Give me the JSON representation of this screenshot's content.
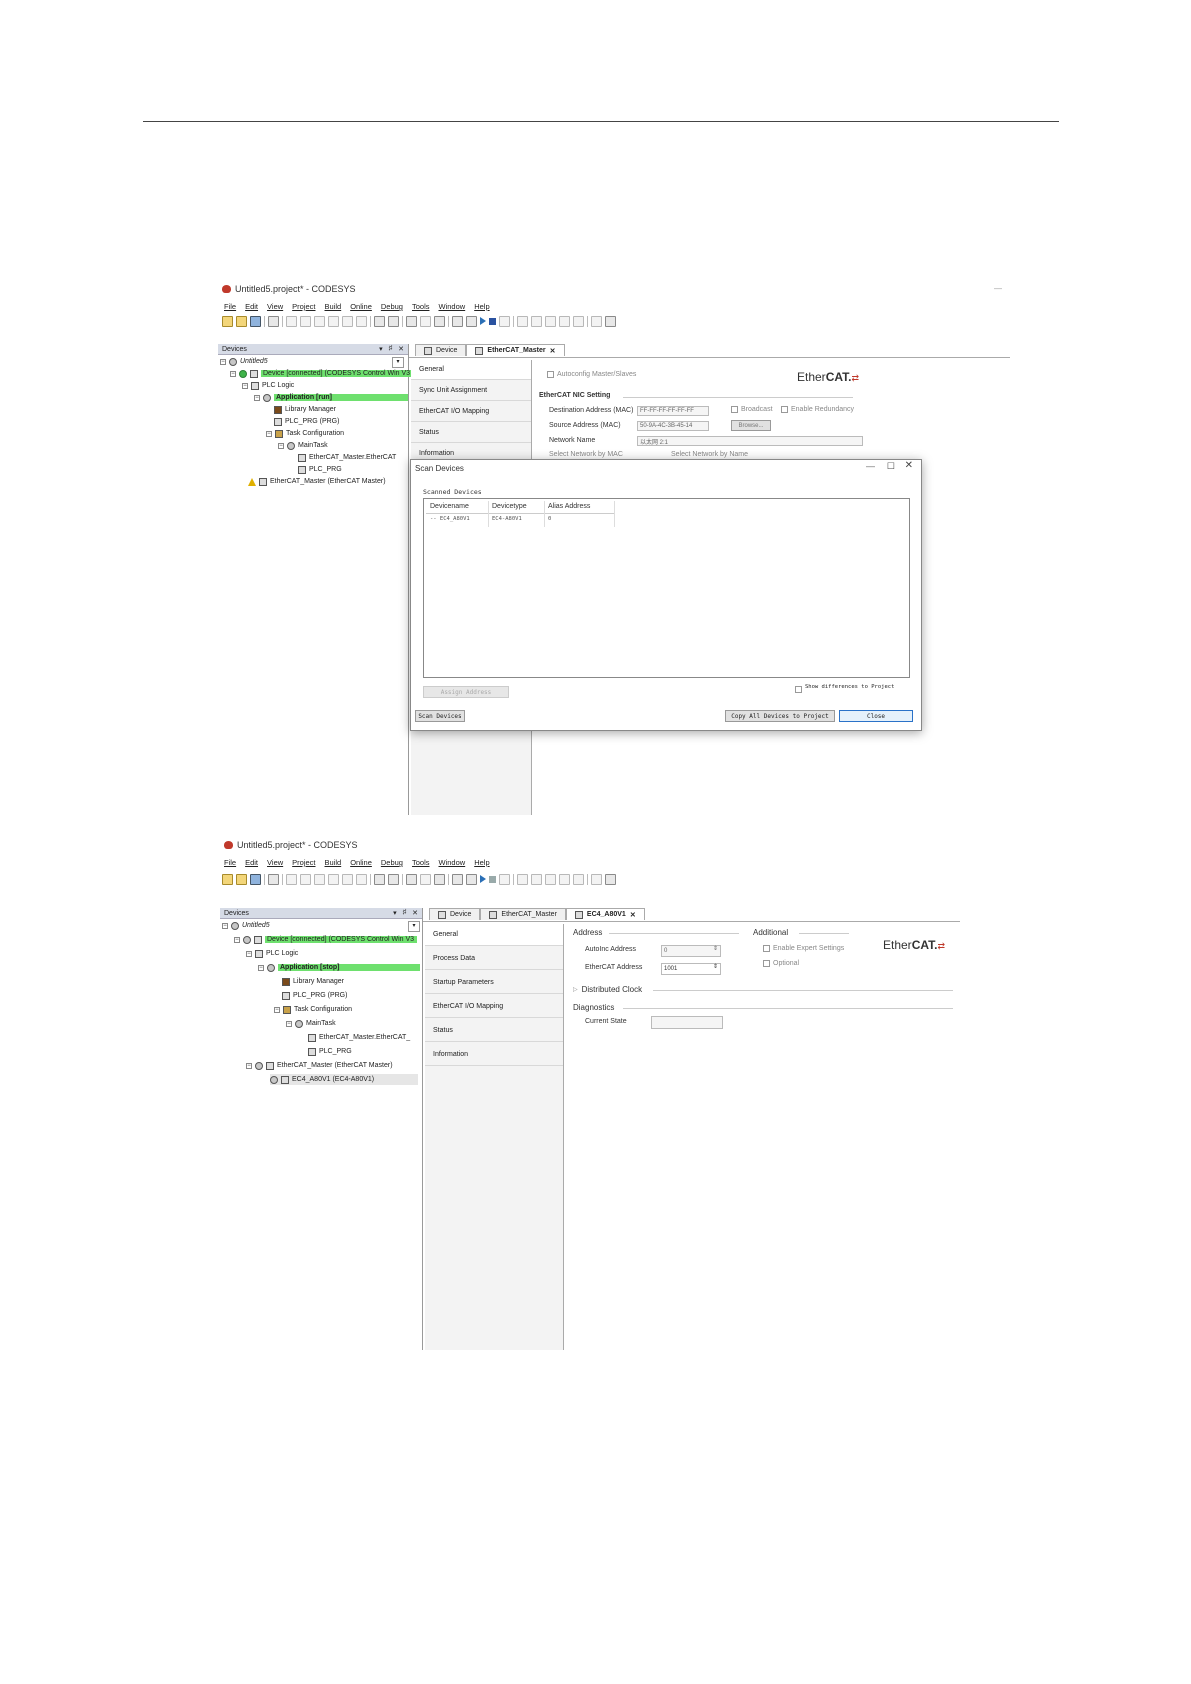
{
  "app": {
    "menu": [
      "File",
      "Edit",
      "View",
      "Project",
      "Build",
      "Online",
      "Debug",
      "Tools",
      "Window",
      "Help"
    ]
  },
  "shot1": {
    "window_title": "Untitled5.project* - CODESYS",
    "devices_panel_title": "Devices",
    "tree": {
      "root": "Untitled5",
      "device": "Device [connected] (CODESYS Control Win V3",
      "plc_logic": "PLC Logic",
      "application": "Application [run]",
      "library_manager": "Library Manager",
      "plc_prg": "PLC_PRG (PRG)",
      "task_config": "Task Configuration",
      "maintask": "MainTask",
      "ethercat_task": "EtherCAT_Master.EtherCAT",
      "plc_prg_call": "PLC_PRG",
      "ethercat_master": "EtherCAT_Master (EtherCAT Master)"
    },
    "tabs": [
      {
        "label": "Device"
      },
      {
        "label": "EtherCAT_Master"
      }
    ],
    "side_tabs": [
      "General",
      "Sync Unit Assignment",
      "EtherCAT I/O Mapping",
      "Status",
      "Information"
    ],
    "general": {
      "autoconfig": "Autoconfig Master/Slaves",
      "nic_section": "EtherCAT NIC Setting",
      "dest_label": "Destination Address (MAC)",
      "dest_value": "FF-FF-FF-FF-FF-FF",
      "broadcast": "Broadcast",
      "redundancy": "Enable Redundancy",
      "source_label": "Source Address (MAC)",
      "source_value": "50-9A-4C-3B-45-14",
      "browse": "Browse...",
      "network_label": "Network Name",
      "network_value": "以太网 2:1",
      "by_mac": "Select Network by MAC",
      "by_name": "Select Network by Name"
    },
    "logo": {
      "ether": "Ether",
      "cat": "CAT."
    },
    "dialog": {
      "title": "Scan Devices",
      "scanned_label": "Scanned Devices",
      "columns": [
        "Devicename",
        "Devicetype",
        "Alias Address"
      ],
      "rows": [
        {
          "name": "-- EC4_A80V1",
          "type": "EC4-A80V1",
          "alias": "0"
        }
      ],
      "assign_address": "Assign Address",
      "save_diff": "Show differences to Project",
      "scan_button": "Scan Devices",
      "copy_button": "Copy All Devices to Project",
      "close_button": "Close"
    }
  },
  "shot2": {
    "window_title": "Untitled5.project* - CODESYS",
    "devices_panel_title": "Devices",
    "tree": {
      "root": "Untitled5",
      "device": "Device [connected] (CODESYS Control Win V3",
      "plc_logic": "PLC Logic",
      "application": "Application [stop]",
      "library_manager": "Library Manager",
      "plc_prg": "PLC_PRG (PRG)",
      "task_config": "Task Configuration",
      "maintask": "MainTask",
      "ethercat_task": "EtherCAT_Master.EtherCAT_",
      "plc_prg_call": "PLC_PRG",
      "ethercat_master": "EtherCAT_Master (EtherCAT Master)",
      "slave": "EC4_A80V1 (EC4-A80V1)"
    },
    "tabs": [
      {
        "label": "Device"
      },
      {
        "label": "EtherCAT_Master"
      },
      {
        "label": "EC4_A80V1"
      }
    ],
    "side_tabs": [
      "General",
      "Process Data",
      "Startup Parameters",
      "EtherCAT I/O Mapping",
      "Status",
      "Information"
    ],
    "general": {
      "address_section": "Address",
      "autoinc_label": "AutoInc Address",
      "autoinc_value": "0",
      "ecat_label": "EtherCAT Address",
      "ecat_value": "1001",
      "additional_section": "Additional",
      "expert": "Enable Expert Settings",
      "optional": "Optional",
      "dc_section": "Distributed Clock",
      "diag_section": "Diagnostics",
      "state_label": "Current State"
    },
    "logo": {
      "ether": "Ether",
      "cat": "CAT."
    }
  }
}
